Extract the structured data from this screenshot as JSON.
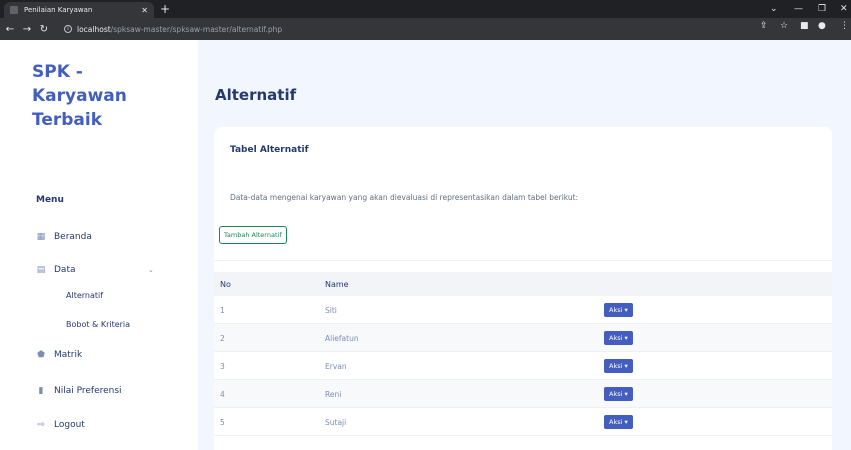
{
  "browser": {
    "tab_title": "Penilaian Karyawan",
    "url_host": "localhost",
    "url_path": "/spksaw-master/spksaw-master/alternatif.php"
  },
  "sidebar": {
    "brand_line1": "SPK -",
    "brand_line2": "Karyawan",
    "brand_line3": "Terbaik",
    "menu_title": "Menu",
    "items": [
      {
        "label": "Beranda",
        "icon": "grid-icon"
      },
      {
        "label": "Data",
        "icon": "file-icon"
      },
      {
        "label": "Matrik",
        "icon": "pentagon-icon"
      },
      {
        "label": "Nilai Preferensi",
        "icon": "bar-chart-icon"
      },
      {
        "label": "Logout",
        "icon": "logout-icon"
      }
    ],
    "sub_items": [
      {
        "label": "Alternatif"
      },
      {
        "label": "Bobot & Kriteria"
      }
    ]
  },
  "main": {
    "page_title": "Alternatif",
    "card_title": "Tabel Alternatif",
    "description": "Data-data mengenai karyawan yang akan dievaluasi di representasikan dalam tabel berikut:",
    "add_button": "Tambah Alternatif",
    "table": {
      "headers": [
        "No",
        "Name"
      ],
      "action_label": "Aksi",
      "rows": [
        {
          "no": "1",
          "name": "Siti"
        },
        {
          "no": "2",
          "name": "Aliefatun"
        },
        {
          "no": "3",
          "name": "Ervan"
        },
        {
          "no": "4",
          "name": "Reni"
        },
        {
          "no": "5",
          "name": "Sutaji"
        }
      ]
    }
  },
  "colors": {
    "primary": "#435ebe",
    "success": "#198754",
    "background": "#f2f7ff",
    "text": "#25396f"
  }
}
